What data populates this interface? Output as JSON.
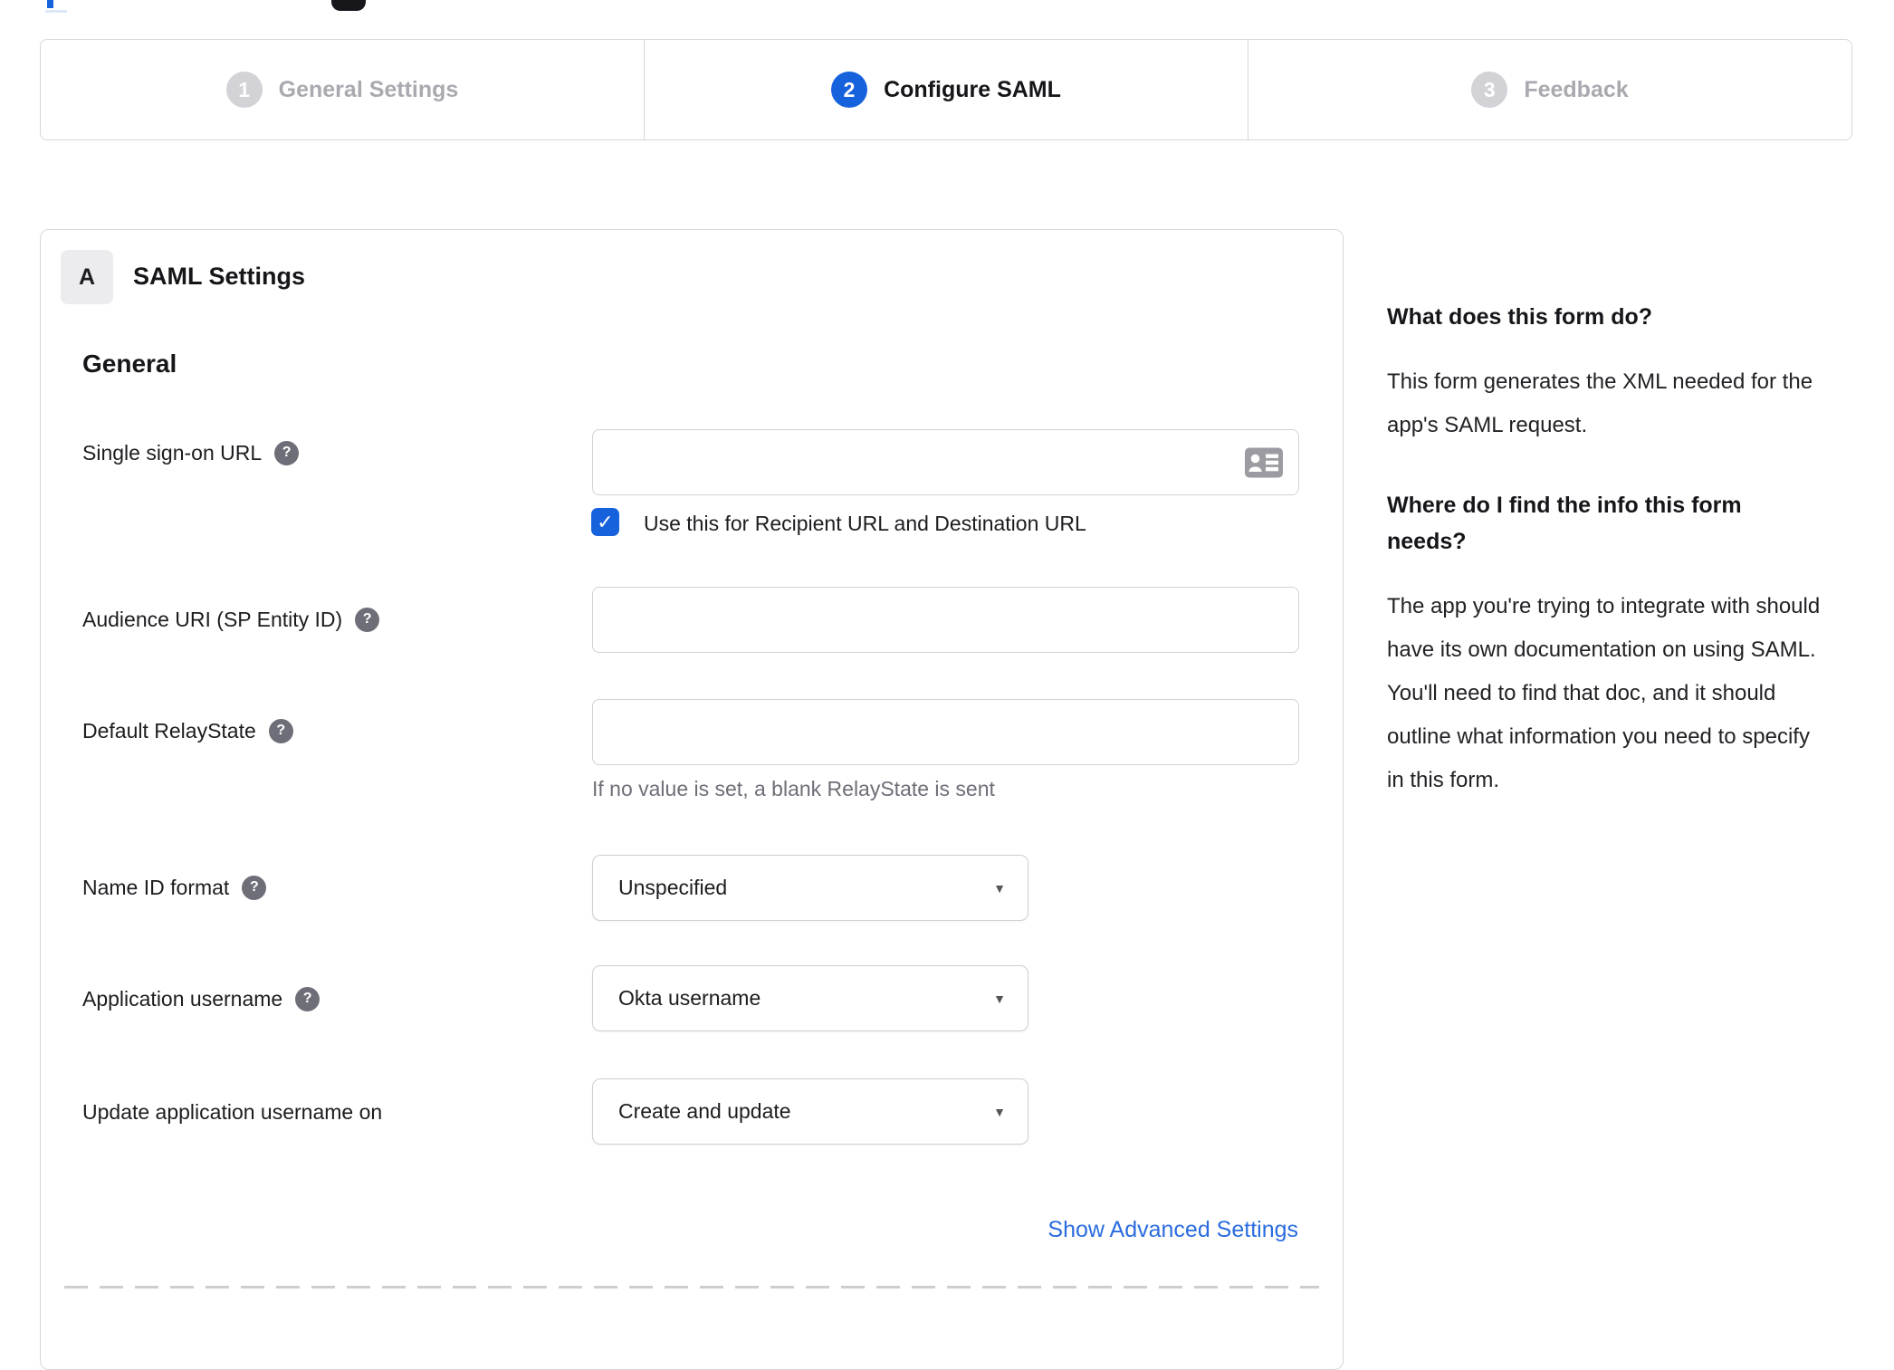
{
  "wizard": {
    "steps": [
      {
        "number": "1",
        "label": "General Settings",
        "state": "inactive"
      },
      {
        "number": "2",
        "label": "Configure SAML",
        "state": "active"
      },
      {
        "number": "3",
        "label": "Feedback",
        "state": "inactive"
      }
    ],
    "active_step": "2"
  },
  "panel": {
    "badge": "A",
    "title": "SAML Settings",
    "section_heading": "General",
    "fields": {
      "sso": {
        "label": "Single sign-on URL",
        "value": "",
        "checkbox_label": "Use this for Recipient URL and Destination URL",
        "checkbox_checked": true
      },
      "audience": {
        "label": "Audience URI (SP Entity ID)",
        "value": ""
      },
      "relay": {
        "label": "Default RelayState",
        "value": "",
        "hint": "If no value is set, a blank RelayState is sent"
      },
      "name_id": {
        "label": "Name ID format",
        "value": "Unspecified"
      },
      "app_username": {
        "label": "Application username",
        "value": "Okta username"
      },
      "update_username": {
        "label": "Update application username on",
        "value": "Create and update"
      }
    },
    "advanced_link": "Show Advanced Settings"
  },
  "sidebar": {
    "sections": [
      {
        "heading": "What does this form do?",
        "body": "This form generates the XML needed for the app's SAML request."
      },
      {
        "heading": "Where do I find the info this form needs?",
        "body": "The app you're trying to integrate with should have its own documentation on using SAML. You'll need to find that doc, and it should outline what information you need to specify in this form."
      }
    ]
  },
  "icons": {
    "help": "?",
    "checkmark": "✓",
    "dropdown_caret": "▼"
  },
  "colors": {
    "primary_blue": "#1662dd",
    "link_blue": "#2a6cdf",
    "border_gray": "#d6d6db",
    "inactive_gray": "#d2d2d7",
    "help_gray": "#6e6e78"
  }
}
